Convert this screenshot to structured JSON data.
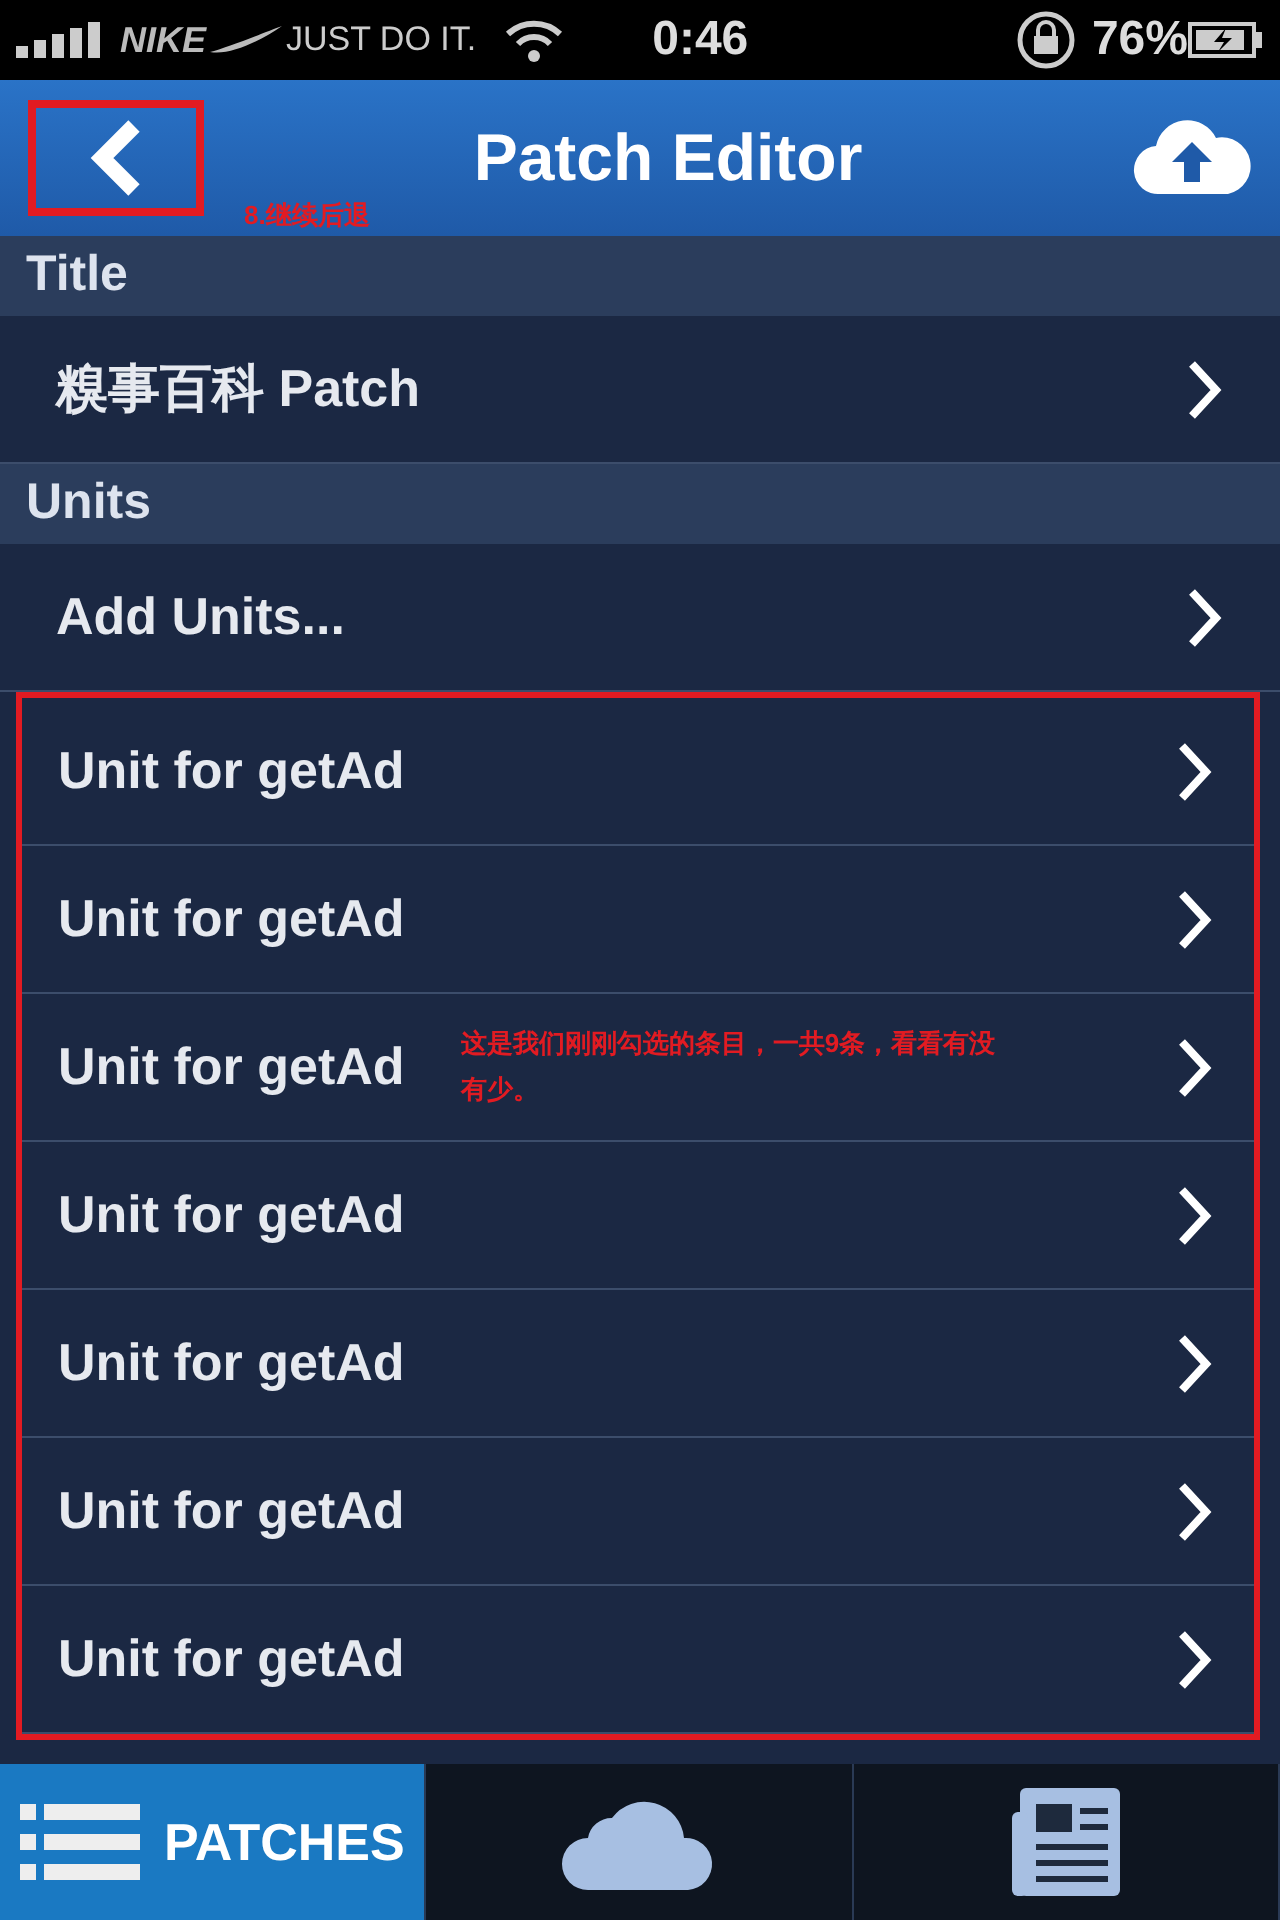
{
  "status_bar": {
    "carrier_logo": "NIKE",
    "carrier": "JUST DO IT.",
    "time": "0:46",
    "battery": "76%"
  },
  "nav_bar": {
    "title": "Patch Editor",
    "annotation": "8.继续后退"
  },
  "sections": [
    {
      "header": "Title",
      "rows": [
        {
          "label": "糗事百科 Patch"
        }
      ]
    },
    {
      "header": "Units",
      "rows": [
        {
          "label": "Add Units..."
        }
      ]
    }
  ],
  "units": {
    "rows": [
      {
        "label": "Unit for getAd"
      },
      {
        "label": "Unit for getAd"
      },
      {
        "label": "Unit for getAd",
        "annotation": "这是我们刚刚勾选的条目，一共9条，看看有没有少。"
      },
      {
        "label": "Unit for getAd"
      },
      {
        "label": "Unit for getAd"
      },
      {
        "label": "Unit for getAd"
      },
      {
        "label": "Unit for getAd"
      }
    ]
  },
  "tab_bar": [
    {
      "kind": "list",
      "label": "PATCHES",
      "selected": true
    },
    {
      "kind": "cloud",
      "selected": false
    },
    {
      "kind": "document",
      "selected": false
    }
  ]
}
